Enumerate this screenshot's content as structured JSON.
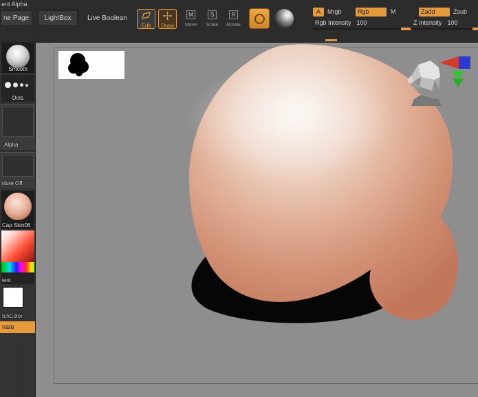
{
  "app": {
    "title_fragment": "ent Alpha"
  },
  "toolbar": {
    "nav": [
      {
        "label": "ne Page"
      },
      {
        "label": "LightBox"
      },
      {
        "label": "Live Boolean"
      }
    ],
    "tools": [
      {
        "label": "Edit"
      },
      {
        "label": "Draw"
      },
      {
        "label": "Move",
        "icon_letter": "M"
      },
      {
        "label": "Scale",
        "icon_letter": "S"
      },
      {
        "label": "Rotate",
        "icon_letter": "R"
      }
    ],
    "modes": {
      "a": "A",
      "mrgb": "Mrgb",
      "rgb": "Rgb",
      "m": "M",
      "zadd": "Zadd",
      "zsub": "Zsub"
    },
    "sliders": [
      {
        "label": "Rgb Intensity",
        "value": "100"
      },
      {
        "label": "Z Intensity",
        "value": "100"
      }
    ]
  },
  "sidebar": {
    "brush": {
      "label": "Smooth"
    },
    "stroke": {
      "label": "Dots"
    },
    "alpha": {
      "label": "Alpha"
    },
    "texture": {
      "label": "xture Off"
    },
    "material": {
      "label": "Cap Skin06"
    },
    "gradient": {
      "label": "ient"
    },
    "switch_color": {
      "label": "tchColor"
    },
    "alternate": {
      "label": "nate"
    }
  },
  "colors": {
    "accent_orange": "#e59a3b",
    "canvas_grey": "#8e8e8e",
    "skin_light": "#f7f0ea",
    "skin_mid": "#e0ae95",
    "skin_dark": "#c2775a",
    "shadow_black": "#060606"
  }
}
